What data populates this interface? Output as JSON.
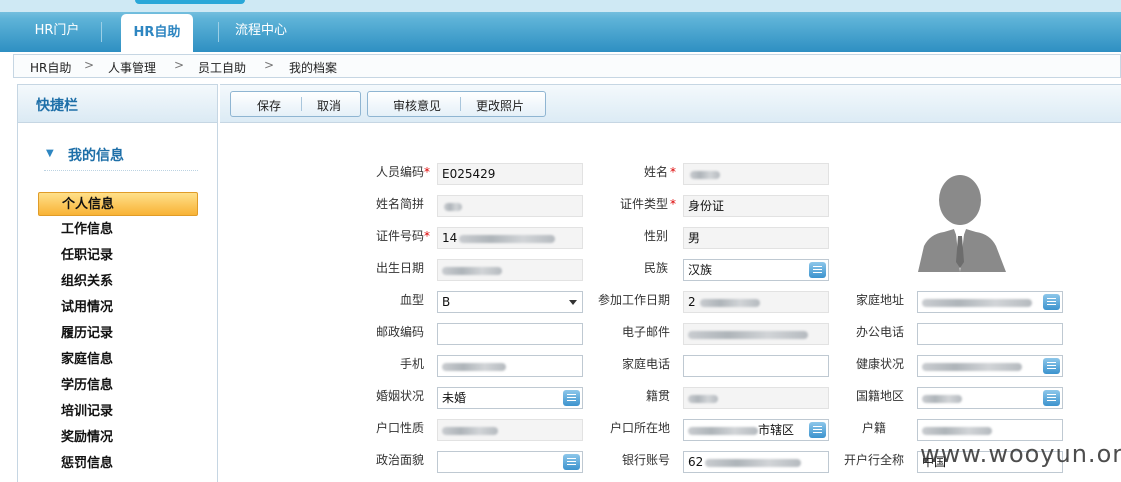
{
  "nav": {
    "tabs": [
      {
        "label": "HR门户"
      },
      {
        "label": "HR自助"
      },
      {
        "label": "流程中心"
      }
    ]
  },
  "breadcrumb": [
    "HR自助",
    "人事管理",
    "员工自助",
    "我的档案"
  ],
  "sidebar": {
    "title": "快捷栏",
    "group": "我的信息",
    "items": [
      "个人信息",
      "工作信息",
      "任职记录",
      "组织关系",
      "试用情况",
      "履历记录",
      "家庭信息",
      "学历信息",
      "培训记录",
      "奖励情况",
      "惩罚信息"
    ]
  },
  "toolbar": {
    "save": "保存",
    "cancel": "取消",
    "review": "审核意见",
    "change_photo": "更改照片"
  },
  "form": {
    "emp_no": {
      "label": "人员编码",
      "value": "E025429"
    },
    "name": {
      "label": "姓名"
    },
    "name_short": {
      "label": "姓名简拼"
    },
    "id_type": {
      "label": "证件类型",
      "value": "身份证"
    },
    "id_no": {
      "label": "证件号码",
      "value": "14"
    },
    "gender": {
      "label": "性别",
      "value": "男"
    },
    "birth": {
      "label": "出生日期"
    },
    "ethnic": {
      "label": "民族",
      "value": "汉族"
    },
    "blood": {
      "label": "血型",
      "value": "B"
    },
    "work_start": {
      "label": "参加工作日期",
      "value": "2"
    },
    "home_addr": {
      "label": "家庭地址"
    },
    "zip": {
      "label": "邮政编码"
    },
    "email": {
      "label": "电子邮件"
    },
    "office_tel": {
      "label": "办公电话"
    },
    "mobile": {
      "label": "手机"
    },
    "home_tel": {
      "label": "家庭电话"
    },
    "health": {
      "label": "健康状况"
    },
    "marital": {
      "label": "婚姻状况",
      "value": "未婚"
    },
    "native": {
      "label": "籍贯"
    },
    "nationality": {
      "label": "国籍地区"
    },
    "hukou_type": {
      "label": "户口性质"
    },
    "hukou_loc": {
      "label": "户口所在地",
      "value": "市辖区"
    },
    "hukou_reg": {
      "label": "户籍"
    },
    "political": {
      "label": "政治面貌"
    },
    "bank_acct": {
      "label": "银行账号",
      "value": "62"
    },
    "bank_name": {
      "label": "开户行全称",
      "value": "中国"
    }
  },
  "watermark": {
    "text": "www.wooyun.org"
  },
  "colors": {
    "accent": "#2e86c1",
    "active": "#f8b336",
    "required": "#dd0000"
  }
}
